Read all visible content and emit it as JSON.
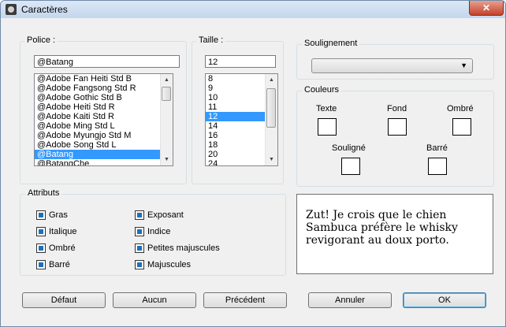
{
  "window": {
    "title": "Caractères",
    "close_glyph": "✕"
  },
  "police": {
    "label": "Police :",
    "value": "@Batang",
    "items": [
      "@Adobe Fan Heiti Std B",
      "@Adobe Fangsong Std R",
      "@Adobe Gothic Std B",
      "@Adobe Heiti Std R",
      "@Adobe Kaiti Std R",
      "@Adobe Ming Std L",
      "@Adobe Myungjo Std M",
      "@Adobe Song Std L",
      "@Batang",
      "@BatangChe"
    ],
    "selected": "@Batang"
  },
  "taille": {
    "label": "Taille :",
    "value": "12",
    "items": [
      "8",
      "9",
      "10",
      "11",
      "12",
      "14",
      "16",
      "18",
      "20",
      "24"
    ],
    "selected": "12"
  },
  "soulignement": {
    "label": "Soulignement",
    "value": ""
  },
  "couleurs": {
    "label": "Couleurs",
    "texte": "Texte",
    "fond": "Fond",
    "ombre": "Ombré",
    "souligne": "Souligné",
    "barre": "Barré"
  },
  "attributs": {
    "label": "Attributs",
    "gras": "Gras",
    "italique": "Italique",
    "ombre": "Ombré",
    "barre": "Barré",
    "exposant": "Exposant",
    "indice": "Indice",
    "petites_majuscules": "Petites majuscules",
    "majuscules": "Majuscules"
  },
  "preview": {
    "line1": "Zut! Je crois que le chien",
    "line2": "Sambuca préfère le whisky",
    "line3": "revigorant au doux porto."
  },
  "buttons": {
    "defaut": "Défaut",
    "aucun": "Aucun",
    "precedent": "Précédent",
    "annuler": "Annuler",
    "ok": "OK"
  },
  "colors": {
    "selection": "#3399ff",
    "checkbox_fill": "#1f6fb5",
    "close_button": "#c2432b"
  },
  "icons": {
    "app": "gear-icon",
    "scroll_up": "chevron-up-icon",
    "scroll_down": "chevron-down-icon",
    "dropdown": "chevron-down-icon"
  }
}
